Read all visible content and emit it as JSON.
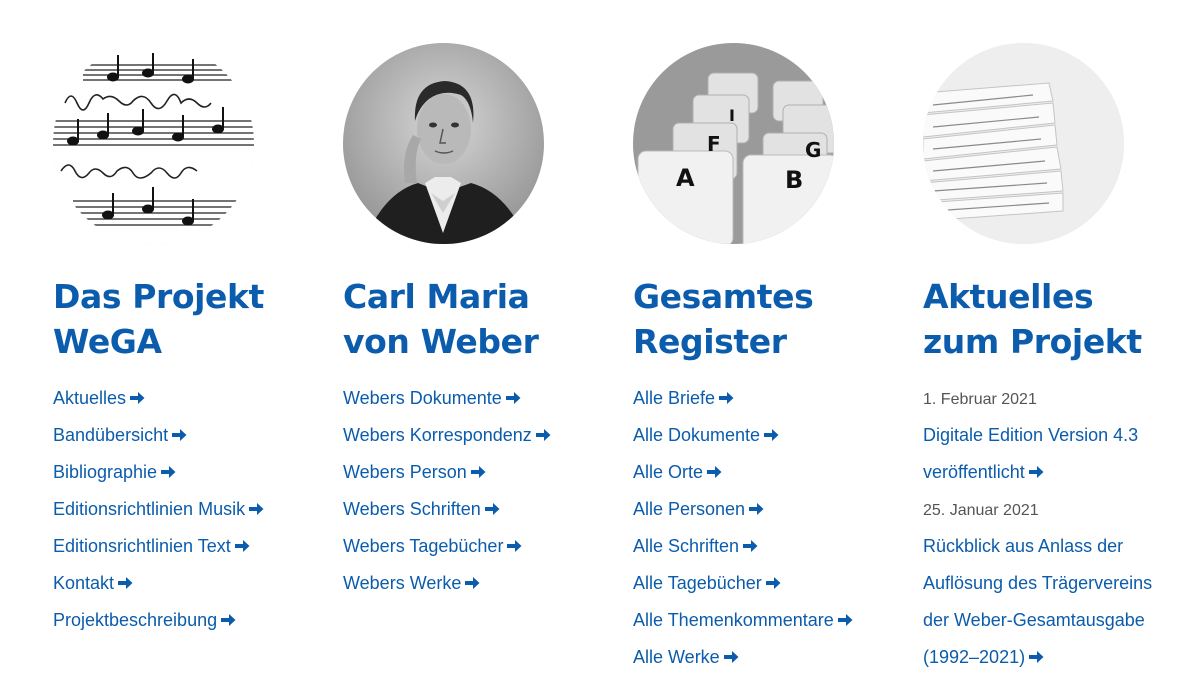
{
  "colors": {
    "accent": "#0b5cad",
    "muted": "#555555",
    "background": "#ffffff"
  },
  "columns": [
    {
      "image_icon": "music-manuscript-image",
      "heading": [
        "Das Projekt",
        "WeGA"
      ],
      "links": [
        "Aktuelles",
        "Bandübersicht",
        "Bibliographie",
        "Editionsrichtlinien Musik",
        "Editionsrichtlinien Text",
        "Kontakt",
        "Projektbeschreibung"
      ]
    },
    {
      "image_icon": "weber-portrait-image",
      "heading": [
        "Carl Maria",
        "von Weber"
      ],
      "links": [
        "Webers Dokumente",
        "Webers Korrespondenz",
        "Webers Person",
        "Webers Schriften",
        "Webers Tagebücher",
        "Webers Werke"
      ]
    },
    {
      "image_icon": "card-index-image",
      "heading": [
        "Gesamtes",
        "Register"
      ],
      "index_card_letters": [
        "A",
        "B",
        "F",
        "G",
        "I"
      ],
      "links": [
        "Alle Briefe",
        "Alle Dokumente",
        "Alle Orte",
        "Alle Personen",
        "Alle Schriften",
        "Alle Tagebücher",
        "Alle Themenkommentare",
        "Alle Werke"
      ]
    },
    {
      "image_icon": "newspaper-stack-image",
      "heading": [
        "Aktuelles",
        "zum Projekt"
      ],
      "news": [
        {
          "date": "1. Februar 2021",
          "title_lines": [
            "Digitale Edition Version 4.3",
            "veröffentlicht"
          ]
        },
        {
          "date": "25. Januar 2021",
          "title_lines": [
            "Rückblick aus Anlass der",
            "Auflösung des Trägervereins",
            "der Weber-Gesamtausgabe",
            "(1992–2021)"
          ]
        }
      ]
    }
  ]
}
